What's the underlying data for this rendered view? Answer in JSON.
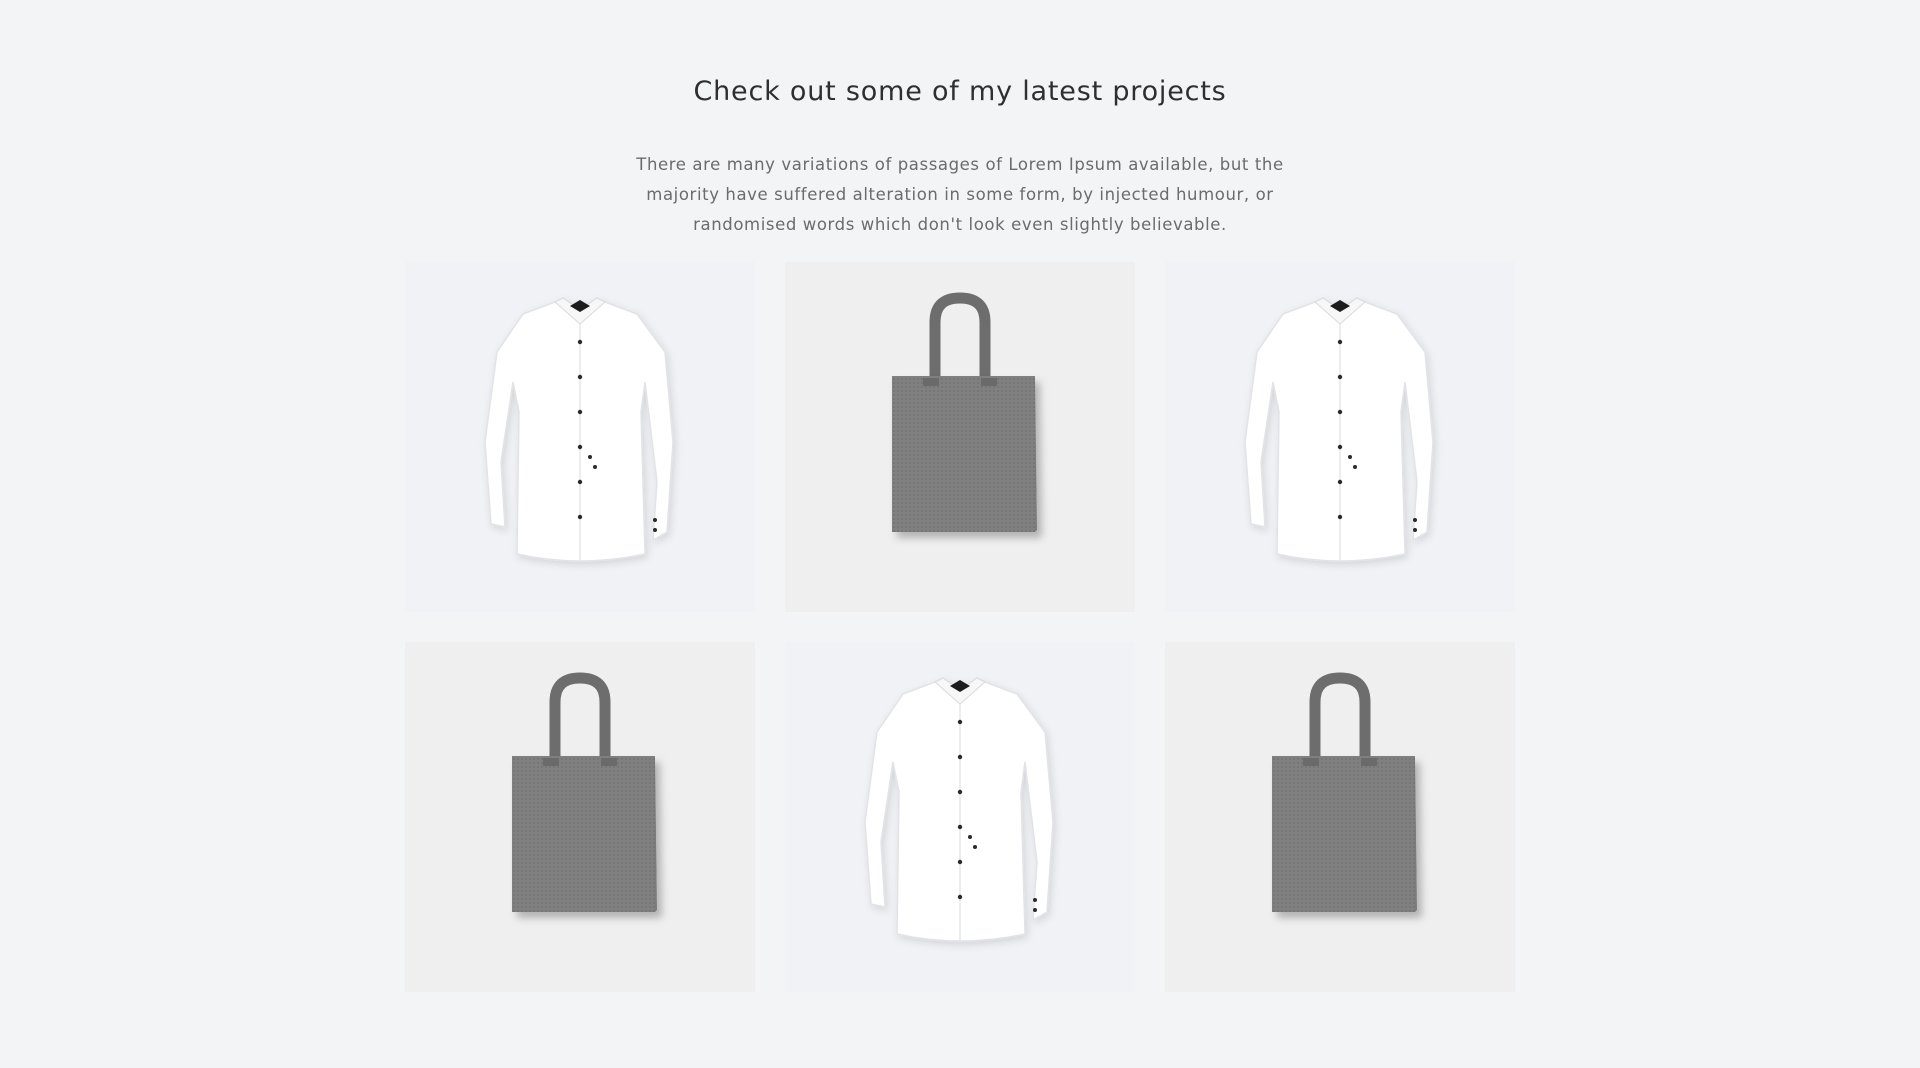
{
  "section": {
    "title": "Check out some of my latest projects",
    "description": "There are many variations of passages of Lorem Ipsum available, but the majority have suffered alteration in some form, by injected humour, or randomised words which don't look even slightly believable."
  },
  "projects": [
    {
      "kind": "shirt",
      "icon": "white-shirt-image"
    },
    {
      "kind": "bag",
      "icon": "gray-tote-bag-image"
    },
    {
      "kind": "shirt",
      "icon": "white-shirt-image"
    },
    {
      "kind": "bag",
      "icon": "gray-tote-bag-image"
    },
    {
      "kind": "shirt",
      "icon": "white-shirt-image"
    },
    {
      "kind": "bag",
      "icon": "gray-tote-bag-image"
    }
  ],
  "colors": {
    "page_background": "#f3f4f6",
    "title_text": "#2f2f2f",
    "body_text": "#6b6b6b",
    "bag_fabric": "#7c7c7c",
    "shirt_fabric": "#ffffff"
  }
}
